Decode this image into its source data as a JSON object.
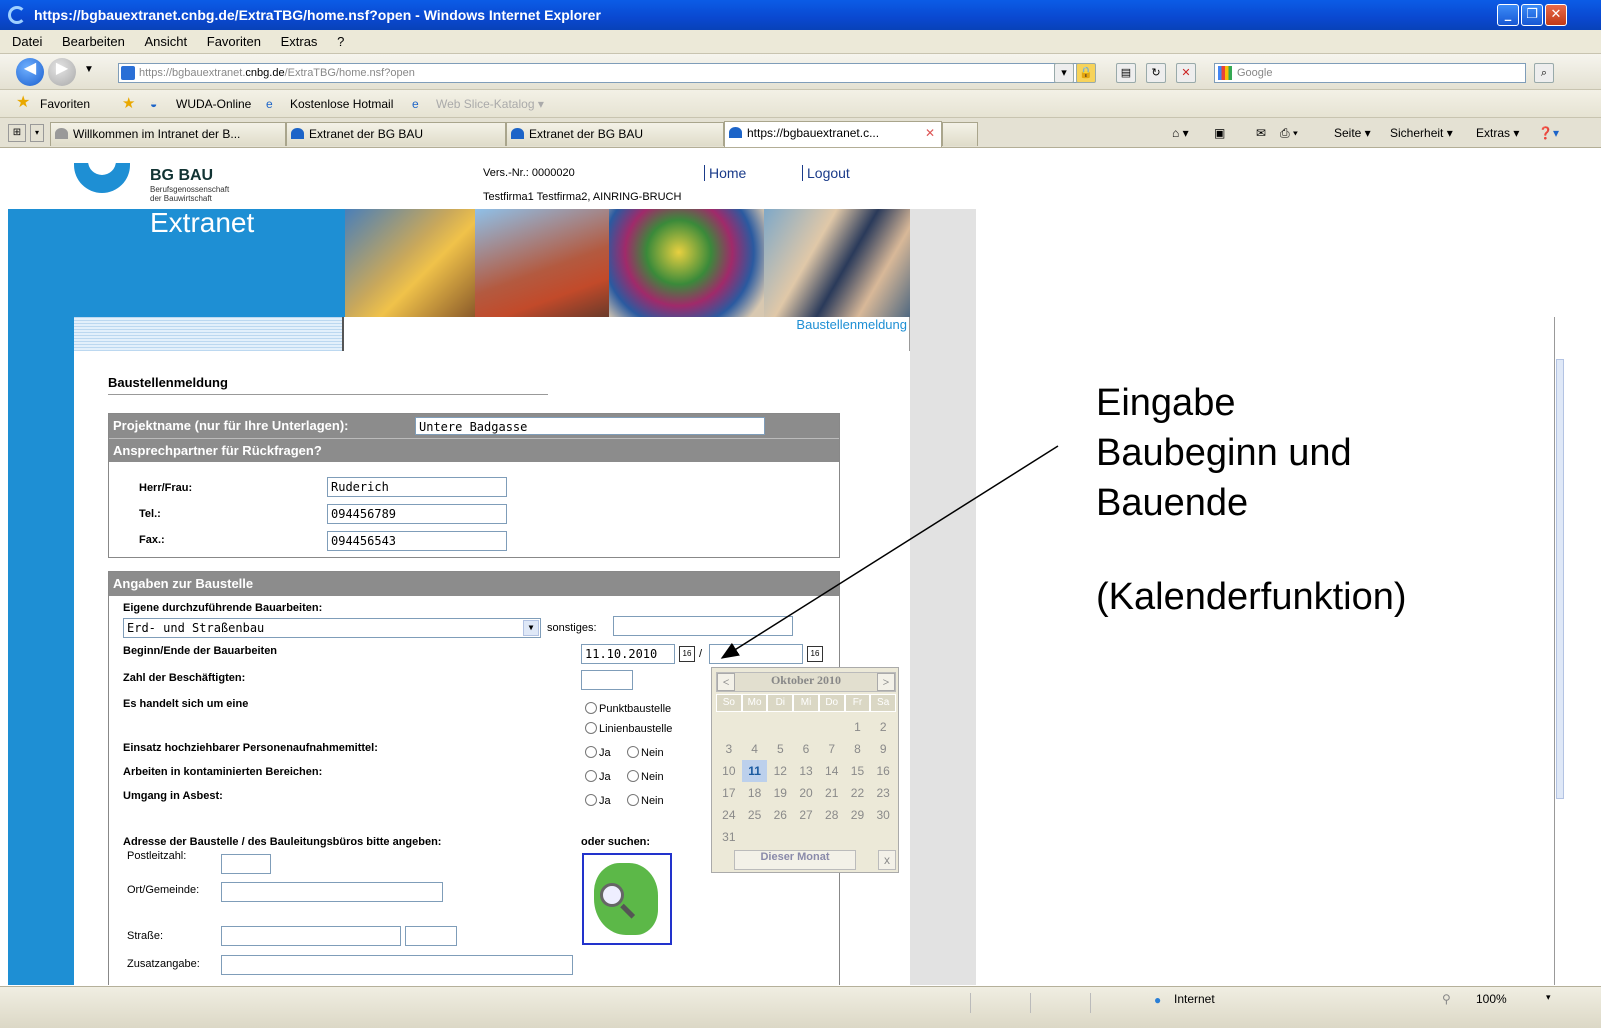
{
  "window": {
    "title": "https://bgbauextranet.cnbg.de/ExtraTBG/home.nsf?open - Windows Internet Explorer"
  },
  "menu": [
    "Datei",
    "Bearbeiten",
    "Ansicht",
    "Favoriten",
    "Extras",
    "?"
  ],
  "address": {
    "prefix": "https://bgbauextranet.",
    "host": "cnbg.de",
    "path": "/ExtraTBG/home.nsf?open"
  },
  "search": {
    "placeholder": "Google"
  },
  "favorites": {
    "label": "Favoriten",
    "items": [
      "WUDA-Online",
      "Kostenlose Hotmail",
      "Web Slice-Katalog ▾"
    ]
  },
  "tabs": [
    "Willkommen im Intranet der B...",
    "Extranet der BG BAU",
    "Extranet der BG BAU",
    "https://bgbauextranet.c..."
  ],
  "commands": [
    "Seite ▾",
    "Sicherheit ▾",
    "Extras ▾"
  ],
  "header": {
    "logo_title": "BG BAU",
    "logo_sub1": "Berufsgenossenschaft",
    "logo_sub2": "der Bauwirtschaft",
    "portal": "Extranet",
    "version": "Vers.-Nr.: 0000020",
    "home": "Home",
    "logout": "Logout",
    "company": "Testfirma1 Testfirma2, AINRING-BRUCH",
    "subnav_label": "Baustellenmeldung"
  },
  "form": {
    "title": "Baustellenmeldung",
    "project_label": "Projektname (nur für Ihre Unterlagen):",
    "project_value": "Untere Badgasse",
    "contact_head": "Ansprechpartner für Rückfragen?",
    "herr_label": "Herr/Frau:",
    "herr_value": "Ruderich",
    "tel_label": "Tel.:",
    "tel_value": "094456789",
    "fax_label": "Fax.:",
    "fax_value": "094456543",
    "site_head": "Angaben zur Baustelle",
    "work_label": "Eigene durchzuführende Bauarbeiten:",
    "work_value": "Erd- und Straßenbau",
    "sonstiges_label": "sonstiges:",
    "dates_label": "Beginn/Ende der Bauarbeiten",
    "begin_value": "11.10.2010",
    "date_sep": "/",
    "staff_label": "Zahl der Beschäftigten:",
    "type_label": "Es handelt sich um eine",
    "type_opt1": "Punktbaustelle",
    "type_opt2": "Linienbaustelle",
    "lift_label": "Einsatz hochziehbarer Personenaufnahmemittel:",
    "contam_label": "Arbeiten in kontaminierten Bereichen:",
    "asbest_label": "Umgang in Asbest:",
    "yes": "Ja",
    "no": "Nein",
    "address_label": "Adresse der Baustelle / des Bauleitungsbüros bitte angeben:",
    "search_label": "oder suchen:",
    "plz_label": "Postleitzahl:",
    "ort_label": "Ort/Gemeinde:",
    "street_label": "Straße:",
    "extra_label": "Zusatzangabe:"
  },
  "calendar": {
    "month": "Oktober 2010",
    "prev": "<",
    "next": ">",
    "weekdays": [
      "So",
      "Mo",
      "Di",
      "Mi",
      "Do",
      "Fr",
      "Sa"
    ],
    "weeks": [
      [
        "",
        "",
        "",
        "",
        "",
        "1",
        "2"
      ],
      [
        "3",
        "4",
        "5",
        "6",
        "7",
        "8",
        "9"
      ],
      [
        "10",
        "11",
        "12",
        "13",
        "14",
        "15",
        "16"
      ],
      [
        "17",
        "18",
        "19",
        "20",
        "21",
        "22",
        "23"
      ],
      [
        "24",
        "25",
        "26",
        "27",
        "28",
        "29",
        "30"
      ],
      [
        "31",
        "",
        "",
        "",
        "",
        "",
        ""
      ]
    ],
    "selected": "11",
    "today_button": "Dieser Monat",
    "close": "x"
  },
  "annotation": {
    "line1": "Eingabe",
    "line2": "Baubeginn und",
    "line3": "Bauende",
    "line4": "(Kalenderfunktion)"
  },
  "status": {
    "zone": "Internet",
    "zoom": "100%"
  }
}
